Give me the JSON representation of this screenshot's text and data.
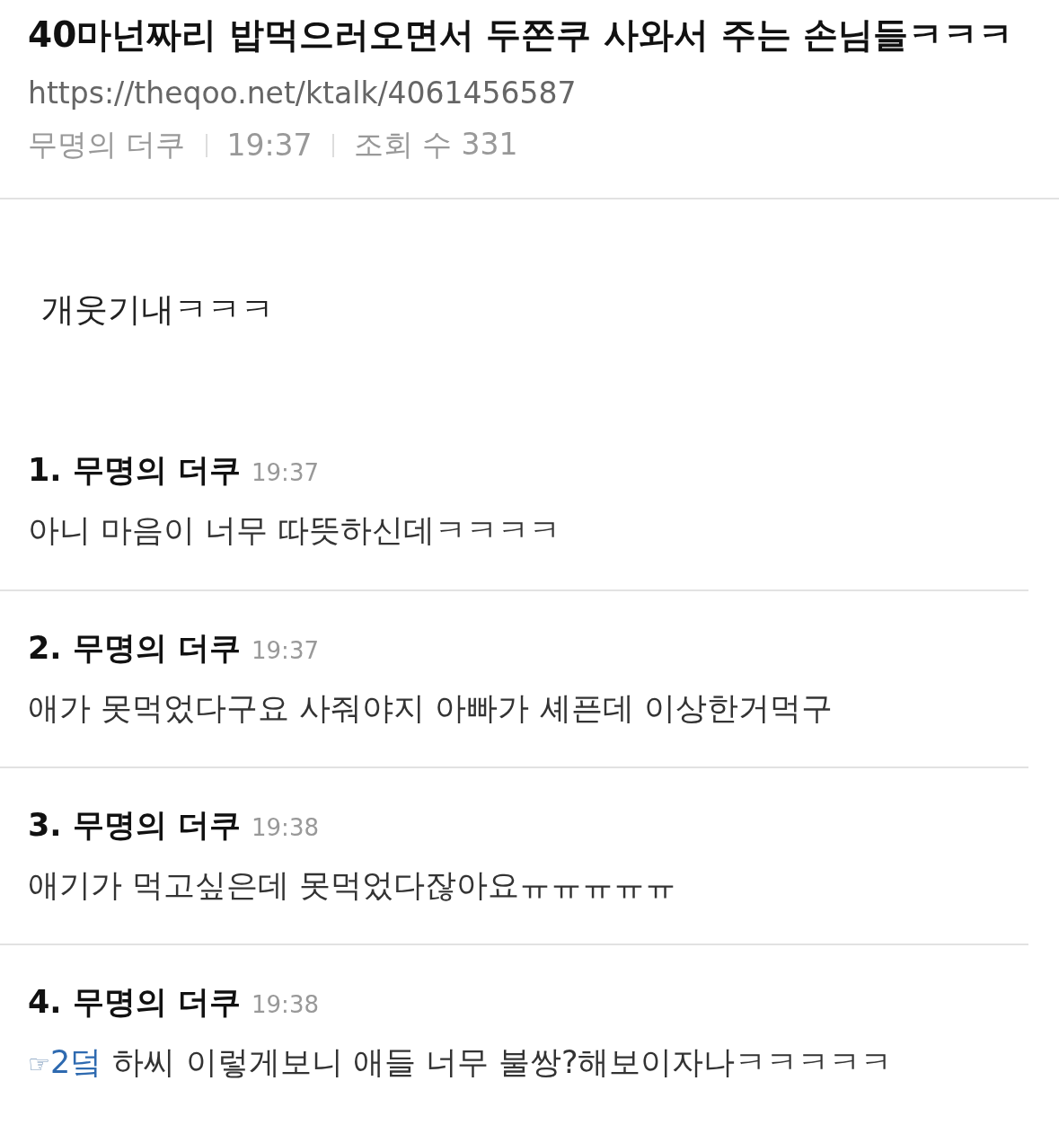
{
  "post": {
    "title": "40마넌짜리 밥먹으러오면서 두쫀쿠 사와서 주는 손님들ㅋㅋㅋ",
    "url": "https://theqoo.net/ktalk/4061456587",
    "author": "무명의 더쿠",
    "time": "19:37",
    "views": "조회 수 331",
    "body": "개웃기내ㅋㅋㅋ"
  },
  "comments": [
    {
      "number": "1.",
      "author": "무명의 더쿠",
      "time": "19:37",
      "text": "아니 마음이 너무 따뜻하신데ㅋㅋㅋㅋ"
    },
    {
      "number": "2.",
      "author": "무명의 더쿠",
      "time": "19:37",
      "text": "애가 못먹었다구요 사줘야지 아빠가 셰픈데 이상한거먹구"
    },
    {
      "number": "3.",
      "author": "무명의 더쿠",
      "time": "19:38",
      "text": "애기가 먹고싶은데 못먹었다잖아요ㅠㅠㅠㅠㅠ"
    },
    {
      "number": "4.",
      "author": "무명의 더쿠",
      "time": "19:38",
      "reply_icon": "☞",
      "reply_to": "2덬",
      "text": "하씨 이렇게보니 애들 너무 불쌍?해보이자나ㅋㅋㅋㅋㅋ"
    }
  ]
}
